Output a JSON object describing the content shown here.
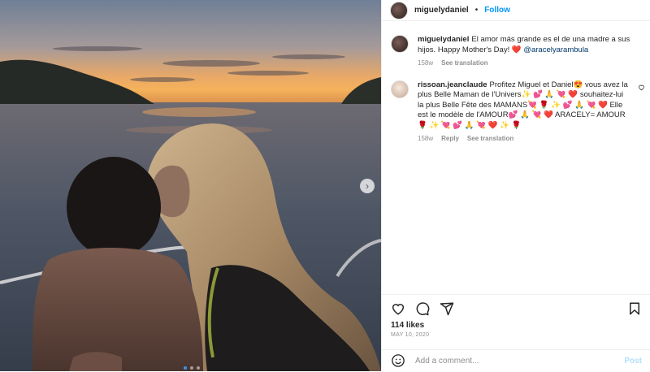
{
  "post": {
    "username": "miguelydaniel",
    "follow_label": "Follow",
    "separator": "•"
  },
  "caption": {
    "username": "miguelydaniel",
    "text": "El amor más grande es el de una madre a sus hijos. Happy Mother's Day! ❤️",
    "mention": "@aracelyarambula",
    "age": "158w",
    "see_translation": "See translation"
  },
  "comment": {
    "username": "rissoan.jeanclaude",
    "text": "Profitez Miguel et Daniel😍 vous avez la plus Belle Maman de l'Univers✨ 💕 🙏 💘 ❤️ souhaitez-lui la plus Belle Fête des MAMANS💘 🌹 ✨ 💕 🙏 💘 ❤️ Elle est le modèle de l'AMOUR💕 🙏 💘 ❤️ ARACELY= AMOUR🌹 ✨ 💘 💕 🙏 💘 ❤️ ✨ 🌹",
    "age": "158w",
    "reply": "Reply",
    "see_translation": "See translation"
  },
  "engagement": {
    "likes": "114 likes",
    "date": "MAY 10, 2020"
  },
  "add_comment": {
    "placeholder": "Add a comment...",
    "post_label": "Post"
  },
  "icons": {
    "like": "heart-icon",
    "comment": "comment-icon",
    "share": "share-icon",
    "save": "bookmark-icon",
    "emoji": "emoji-icon",
    "next": "chevron-right-icon"
  },
  "colors": {
    "accent": "#0095f6",
    "post_disabled": "#b2dffc",
    "muted": "#8e8e8e",
    "carousel_active": "#3897f0"
  },
  "carousel": {
    "slide_count": 3,
    "active_index": 0
  }
}
